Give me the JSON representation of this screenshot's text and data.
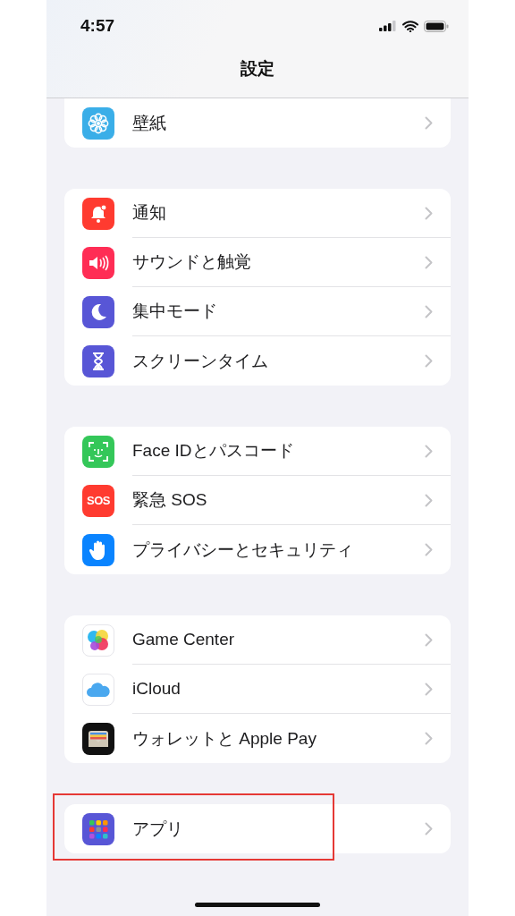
{
  "status_bar": {
    "time": "4:57"
  },
  "nav": {
    "title": "設定"
  },
  "groups": [
    {
      "items": [
        {
          "label": "壁紙",
          "highlighted": false
        }
      ]
    },
    {
      "items": [
        {
          "label": "通知",
          "highlighted": false
        },
        {
          "label": "サウンドと触覚",
          "highlighted": false
        },
        {
          "label": "集中モード",
          "highlighted": false
        },
        {
          "label": "スクリーンタイム",
          "highlighted": false
        }
      ]
    },
    {
      "items": [
        {
          "label": "Face IDとパスコード",
          "highlighted": false
        },
        {
          "label": "緊急 SOS",
          "icon_text": "SOS",
          "highlighted": false
        },
        {
          "label": "プライバシーとセキュリティ",
          "highlighted": false
        }
      ]
    },
    {
      "items": [
        {
          "label": "Game Center",
          "highlighted": false
        },
        {
          "label": "iCloud",
          "highlighted": false
        },
        {
          "label": "ウォレットと Apple Pay",
          "highlighted": false
        }
      ]
    },
    {
      "items": [
        {
          "label": "アプリ",
          "highlighted": true
        }
      ]
    }
  ]
}
